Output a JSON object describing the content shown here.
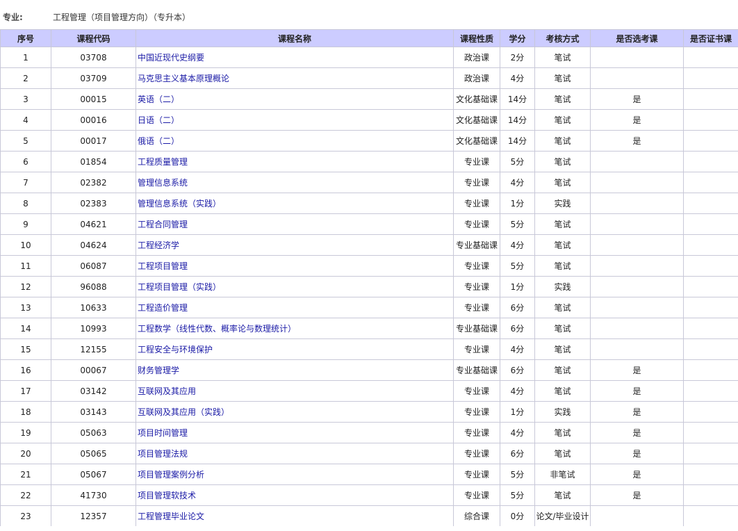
{
  "major": {
    "label": "专业:",
    "value": "工程管理（项目管理方向）（专升本）"
  },
  "headers": [
    "序号",
    "课程代码",
    "课程名称",
    "课程性质",
    "学分",
    "考核方式",
    "是否选考课",
    "是否证书课"
  ],
  "rows": [
    [
      "1",
      "03708",
      "中国近现代史纲要",
      "政治课",
      "2分",
      "笔试",
      "",
      ""
    ],
    [
      "2",
      "03709",
      "马克思主义基本原理概论",
      "政治课",
      "4分",
      "笔试",
      "",
      ""
    ],
    [
      "3",
      "00015",
      "英语（二）",
      "文化基础课",
      "14分",
      "笔试",
      "是",
      ""
    ],
    [
      "4",
      "00016",
      "日语（二）",
      "文化基础课",
      "14分",
      "笔试",
      "是",
      ""
    ],
    [
      "5",
      "00017",
      "俄语（二）",
      "文化基础课",
      "14分",
      "笔试",
      "是",
      ""
    ],
    [
      "6",
      "01854",
      "工程质量管理",
      "专业课",
      "5分",
      "笔试",
      "",
      ""
    ],
    [
      "7",
      "02382",
      "管理信息系统",
      "专业课",
      "4分",
      "笔试",
      "",
      ""
    ],
    [
      "8",
      "02383",
      "管理信息系统（实践）",
      "专业课",
      "1分",
      "实践",
      "",
      ""
    ],
    [
      "9",
      "04621",
      "工程合同管理",
      "专业课",
      "5分",
      "笔试",
      "",
      ""
    ],
    [
      "10",
      "04624",
      "工程经济学",
      "专业基础课",
      "4分",
      "笔试",
      "",
      ""
    ],
    [
      "11",
      "06087",
      "工程项目管理",
      "专业课",
      "5分",
      "笔试",
      "",
      ""
    ],
    [
      "12",
      "96088",
      "工程项目管理（实践）",
      "专业课",
      "1分",
      "实践",
      "",
      ""
    ],
    [
      "13",
      "10633",
      "工程造价管理",
      "专业课",
      "6分",
      "笔试",
      "",
      ""
    ],
    [
      "14",
      "10993",
      "工程数学（线性代数、概率论与数理统计）",
      "专业基础课",
      "6分",
      "笔试",
      "",
      ""
    ],
    [
      "15",
      "12155",
      "工程安全与环境保护",
      "专业课",
      "4分",
      "笔试",
      "",
      ""
    ],
    [
      "16",
      "00067",
      "财务管理学",
      "专业基础课",
      "6分",
      "笔试",
      "是",
      ""
    ],
    [
      "17",
      "03142",
      "互联网及其应用",
      "专业课",
      "4分",
      "笔试",
      "是",
      ""
    ],
    [
      "18",
      "03143",
      "互联网及其应用（实践）",
      "专业课",
      "1分",
      "实践",
      "是",
      ""
    ],
    [
      "19",
      "05063",
      "项目时间管理",
      "专业课",
      "4分",
      "笔试",
      "是",
      ""
    ],
    [
      "20",
      "05065",
      "项目管理法规",
      "专业课",
      "6分",
      "笔试",
      "是",
      ""
    ],
    [
      "21",
      "05067",
      "项目管理案例分析",
      "专业课",
      "5分",
      "非笔试",
      "是",
      ""
    ],
    [
      "22",
      "41730",
      "项目管理软技术",
      "专业课",
      "5分",
      "笔试",
      "是",
      ""
    ],
    [
      "23",
      "12357",
      "工程管理毕业论文",
      "综合课",
      "0分",
      "论文/毕业设计",
      "",
      ""
    ]
  ]
}
